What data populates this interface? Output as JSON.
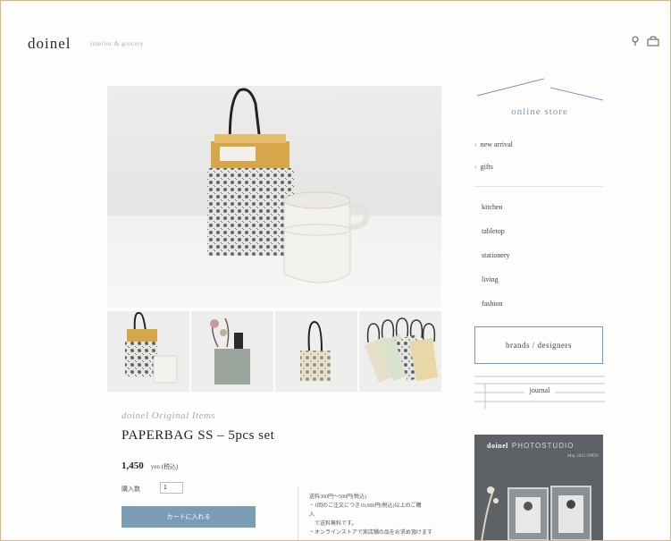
{
  "header": {
    "logo": "doinel",
    "tagline": "interior & grocery",
    "icons": [
      "search-icon",
      "bag-icon"
    ]
  },
  "product": {
    "brand": "doinel Original Items",
    "title": "PAPERBAG SS – 5pcs set",
    "price": "1,450",
    "tax_note": "yen (税込)",
    "qty_label": "購入数",
    "qty_value": "1",
    "cart_button": "カートに入れる",
    "notes": [
      "送料300円～500円(税込)",
      "・1回のご注文につき10,000円(税込)以上のご購",
      "入",
      "　で送料無料です。",
      "・オンラインストアで実店舗の品をお求め頂けます"
    ]
  },
  "sidebar": {
    "store_title": "online store",
    "features": [
      "new arrival",
      "gifts"
    ],
    "categories": [
      "kitchen",
      "tabletop",
      "stationery",
      "living",
      "fashion"
    ],
    "brands_label": "brands / designers",
    "journal_label": "journal",
    "banner": {
      "brand": "doinel",
      "title": "PHOTOSTUDIO",
      "sub": "May 2021 OPEN"
    }
  },
  "colors": {
    "accent": "#7c96b5",
    "cart_button": "#7a9cb5",
    "frame": "#c9b79a"
  }
}
